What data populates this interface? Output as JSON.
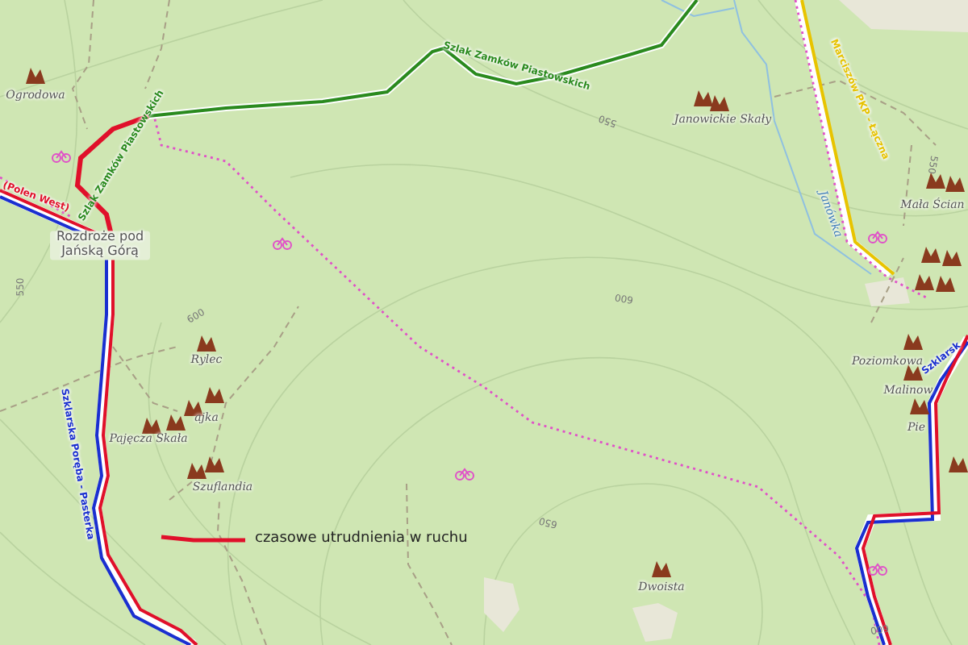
{
  "map": {
    "peaks": [
      {
        "name": "Ogrodowa"
      },
      {
        "name": "Janowickie Skały"
      },
      {
        "name": "Mała Ścian"
      },
      {
        "name": "Rylec"
      },
      {
        "name": "ajka"
      },
      {
        "name": "Pajęcza Skała"
      },
      {
        "name": "Szuflandia"
      },
      {
        "name": "Poziomkowa"
      },
      {
        "name": "Malinow"
      },
      {
        "name": "Pie"
      },
      {
        "name": "Dwoista"
      }
    ],
    "place_labels": [
      {
        "name": "Rozdroże pod Jańską Górą"
      }
    ],
    "trail_labels": [
      {
        "name": "Szlak Zamków Piastowskich",
        "color": "#2a8a1e"
      },
      {
        "name": "Szlak Zamków Piastowskich",
        "color": "#2a8a1e"
      },
      {
        "name": "(Polen West)",
        "color": "#e0102a"
      },
      {
        "name": "Marciszów PKP - Łączna",
        "color": "#e6c200"
      },
      {
        "name": "Szklarska Poręba - Pasterka",
        "color": "#1a2fd0"
      },
      {
        "name": "Szklarsk",
        "color": "#1a2fd0"
      }
    ],
    "water_labels": [
      {
        "name": "Janówka"
      }
    ],
    "contour_labels": [
      "550",
      "550",
      "550",
      "600",
      "600",
      "650",
      "600"
    ],
    "legend": {
      "label": "czasowe utrudnienia w ruchu"
    }
  }
}
